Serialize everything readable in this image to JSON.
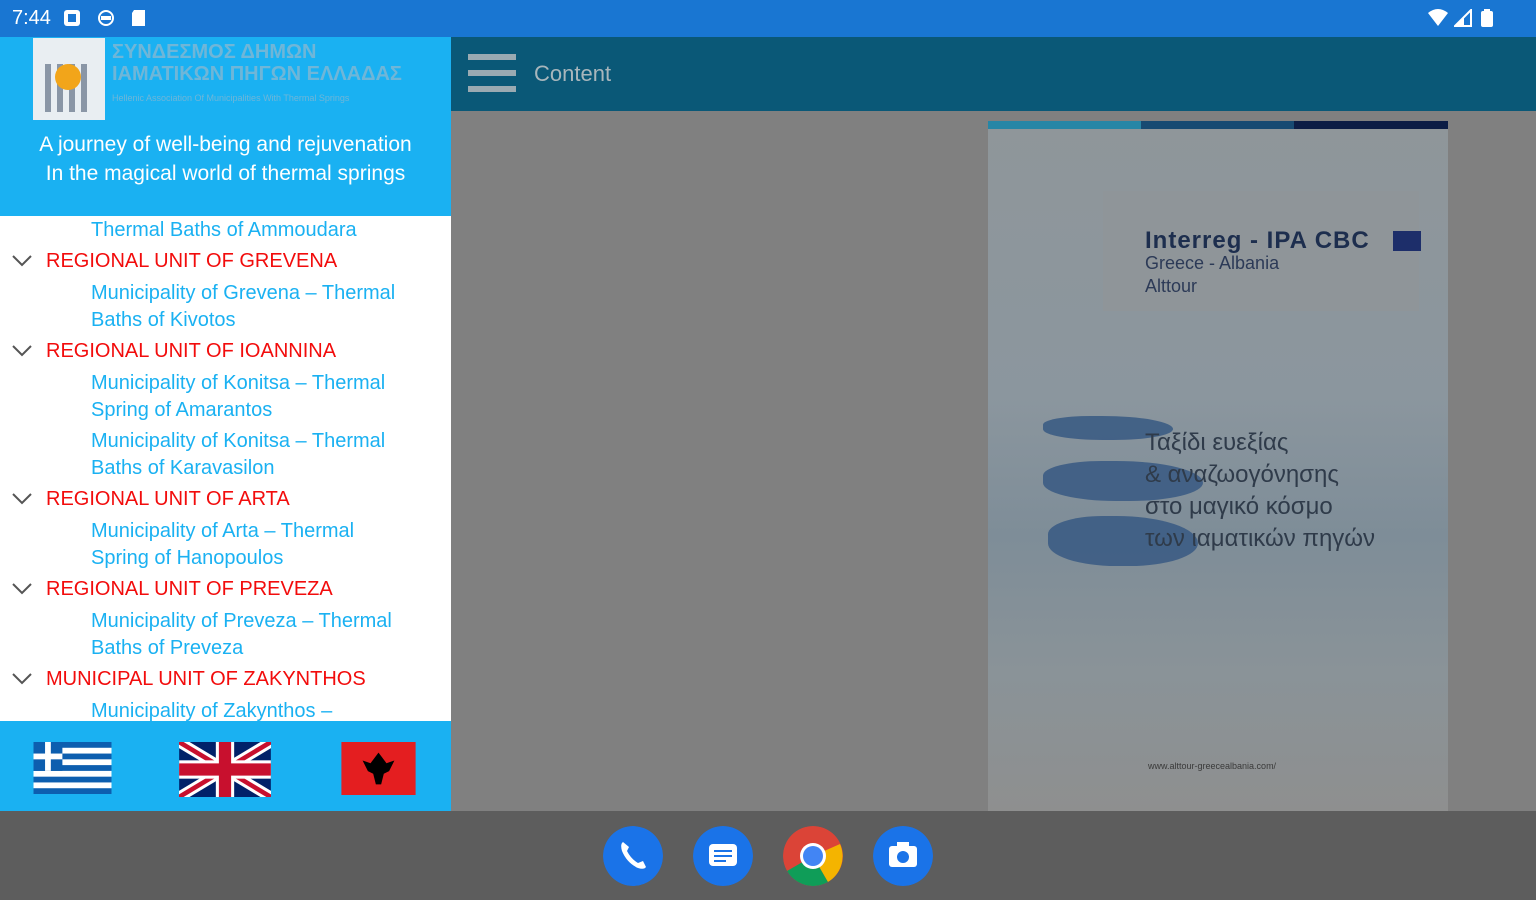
{
  "status_bar": {
    "time": "7:44"
  },
  "app_bar": {
    "title": "Content"
  },
  "drawer": {
    "org_title_line1": "ΣΥΝΔΕΣΜΟΣ ΔΗΜΩΝ",
    "org_title_line2": "ΙΑΜΑΤΙΚΩΝ ΠΗΓΩΝ ΕΛΛΑΔΑΣ",
    "org_subtitle": "Hellenic Association Of Municipalities With Thermal Springs",
    "tagline_line1": "A journey of well-being and rejuvenation",
    "tagline_line2": "In the magical world of thermal springs",
    "items": [
      {
        "type": "muni",
        "line1": "Thermal Baths of Ammoudara",
        "line2": ""
      },
      {
        "type": "region",
        "label": "REGIONAL UNIT OF GREVENA"
      },
      {
        "type": "muni",
        "line1": "Municipality of Grevena – Thermal",
        "line2": "Baths of Kivotos"
      },
      {
        "type": "region",
        "label": "REGIONAL UNIT OF IOANNINA"
      },
      {
        "type": "muni",
        "line1": "Municipality of Konitsa – Thermal",
        "line2": "Spring of Amarantos"
      },
      {
        "type": "muni",
        "line1": "Municipality of Konitsa – Thermal",
        "line2": "Baths of Karavasilon"
      },
      {
        "type": "region",
        "label": "REGIONAL UNIT OF ARTA"
      },
      {
        "type": "muni",
        "line1": "Municipality of Arta – Thermal",
        "line2": "Spring of Hanopoulos"
      },
      {
        "type": "region",
        "label": "REGIONAL UNIT OF PREVEZA"
      },
      {
        "type": "muni",
        "line1": "Municipality of Preveza – Thermal",
        "line2": "Baths of Preveza"
      },
      {
        "type": "region",
        "label": "MUNICIPAL UNIT OF ZAKYNTHOS"
      },
      {
        "type": "muni",
        "line1": "Municipality of Zakynthos –",
        "line2": ""
      }
    ],
    "languages": [
      "greek-flag",
      "uk-flag",
      "albanian-flag"
    ]
  },
  "poster": {
    "brand": "Interreg - IPA CBC",
    "sub1": "Greece - Albania",
    "sub2": "Alttour",
    "greek_line1": "Ταξίδι ευεξίας",
    "greek_line2": "& αναζωογόνησης",
    "greek_line3": "στο μαγικό κόσμο",
    "greek_line4": "των ιαματικών πηγών",
    "url": "www.alttour-greecealbania.com/"
  },
  "dock": [
    "phone-icon",
    "messages-icon",
    "chrome-icon",
    "camera-icon"
  ],
  "colors": {
    "status_bar": "#1976d2",
    "drawer_accent": "#1ab1f2",
    "region_text": "#f20c0c",
    "app_bar": "#0a5877"
  }
}
